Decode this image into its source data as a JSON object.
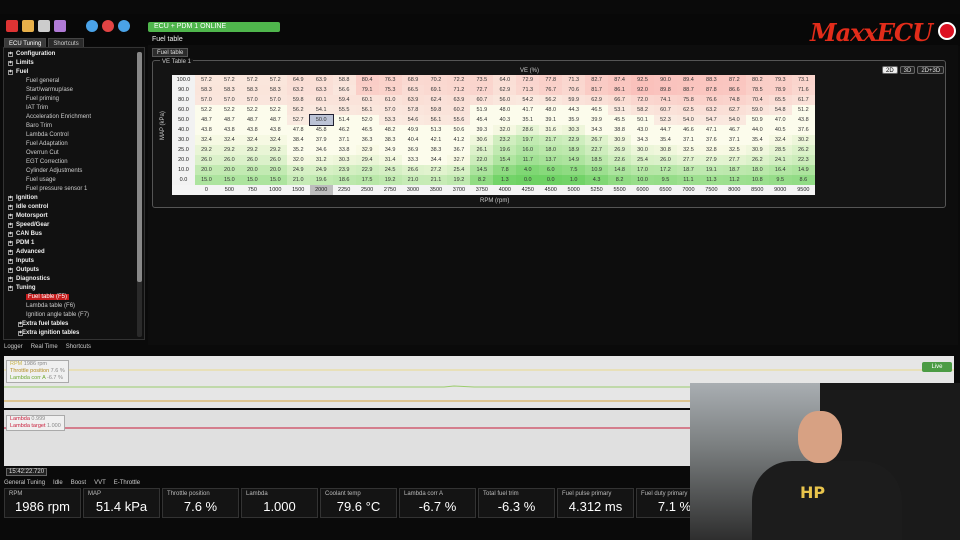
{
  "app": {
    "status": "ECU + PDM 1 ONLINE",
    "panel_title": "Fuel table",
    "logo": "MaxxECU"
  },
  "toolbar_icons": [
    "close-icon",
    "folder-icon",
    "save-icon",
    "settings-icon",
    "info-icon",
    "record-icon",
    "download-icon"
  ],
  "left_tabs": [
    "ECU Tuning",
    "Shortcuts"
  ],
  "sidebar": [
    {
      "label": "Configuration",
      "level": "top"
    },
    {
      "label": "Limits",
      "level": "top"
    },
    {
      "label": "Fuel",
      "level": "top"
    },
    {
      "label": "Fuel general",
      "level": "sub"
    },
    {
      "label": "Start/warmup/ase",
      "level": "sub"
    },
    {
      "label": "Fuel priming",
      "level": "sub"
    },
    {
      "label": "IAT Trim",
      "level": "sub"
    },
    {
      "label": "Acceleration Enrichment",
      "level": "sub"
    },
    {
      "label": "Baro Trim",
      "level": "sub"
    },
    {
      "label": "Lambda Control",
      "level": "sub"
    },
    {
      "label": "Fuel Adaptation",
      "level": "sub"
    },
    {
      "label": "Overrun Cut",
      "level": "sub"
    },
    {
      "label": "EGT Correction",
      "level": "sub"
    },
    {
      "label": "Cylinder Adjustments",
      "level": "sub"
    },
    {
      "label": "Fuel usage",
      "level": "sub"
    },
    {
      "label": "Fuel pressure sensor 1",
      "level": "sub"
    },
    {
      "label": "Ignition",
      "level": "top"
    },
    {
      "label": "Idle control",
      "level": "top"
    },
    {
      "label": "Motorsport",
      "level": "top"
    },
    {
      "label": "Speed/Gear",
      "level": "top"
    },
    {
      "label": "CAN Bus",
      "level": "top"
    },
    {
      "label": "PDM 1",
      "level": "top"
    },
    {
      "label": "Advanced",
      "level": "top"
    },
    {
      "label": "Inputs",
      "level": "top"
    },
    {
      "label": "Outputs",
      "level": "top"
    },
    {
      "label": "Diagnostics",
      "level": "top"
    },
    {
      "label": "Tuning",
      "level": "top"
    },
    {
      "label": "Fuel table (F5)",
      "level": "sub",
      "selected": true
    },
    {
      "label": "Lambda table (F6)",
      "level": "sub"
    },
    {
      "label": "Ignition angle table (F7)",
      "level": "sub"
    },
    {
      "label": "Extra fuel tables",
      "level": "sub2"
    },
    {
      "label": "Extra ignition tables",
      "level": "sub2"
    }
  ],
  "fuel_tab": "Fuel table",
  "ve_table": {
    "group_label": "VE Table 1",
    "title": "VE (%)",
    "y_axis_label": "MAP (kPa)",
    "x_axis_label": "RPM (rpm)",
    "view_buttons": [
      "2D",
      "3D",
      "2D+3D"
    ],
    "rpm": [
      "0",
      "500",
      "750",
      "1000",
      "1500",
      "2000",
      "2250",
      "2500",
      "2750",
      "3000",
      "3500",
      "3700",
      "3750",
      "4000",
      "4250",
      "4500",
      "5000",
      "5250",
      "5500",
      "6000",
      "6500",
      "7000",
      "7500",
      "8000",
      "8500",
      "9000",
      "9500"
    ],
    "map": [
      "100.0",
      "90.0",
      "80.0",
      "60.0",
      "50.0",
      "40.0",
      "30.0",
      "25.0",
      "20.0",
      "10.0",
      "0.0"
    ],
    "rows": [
      [
        "57.2",
        "57.2",
        "57.2",
        "57.2",
        "64.9",
        "63.9",
        "58.8",
        "80.4",
        "76.3",
        "68.9",
        "70.2",
        "72.2",
        "73.5",
        "64.0",
        "72.9",
        "77.8",
        "71.3",
        "82.7",
        "87.4",
        "92.5",
        "90.0",
        "89.4",
        "88.3",
        "87.2",
        "80.2",
        "79.3",
        "73.1"
      ],
      [
        "58.3",
        "58.3",
        "58.3",
        "58.3",
        "63.2",
        "63.3",
        "56.6",
        "79.1",
        "75.3",
        "66.5",
        "69.1",
        "71.2",
        "72.7",
        "62.9",
        "71.3",
        "76.7",
        "70.6",
        "81.7",
        "86.1",
        "92.0",
        "89.8",
        "88.7",
        "87.8",
        "86.6",
        "78.5",
        "78.9",
        "71.6"
      ],
      [
        "57.0",
        "57.0",
        "57.0",
        "57.0",
        "59.8",
        "60.1",
        "59.4",
        "60.1",
        "61.0",
        "63.9",
        "62.4",
        "63.9",
        "60.7",
        "56.0",
        "54.2",
        "56.2",
        "59.9",
        "62.9",
        "66.7",
        "72.0",
        "74.1",
        "75.8",
        "76.6",
        "74.8",
        "70.4",
        "65.5",
        "61.7"
      ],
      [
        "52.2",
        "52.2",
        "52.2",
        "52.2",
        "56.2",
        "54.1",
        "55.5",
        "56.1",
        "57.0",
        "57.8",
        "59.8",
        "60.2",
        "51.9",
        "48.0",
        "41.7",
        "48.0",
        "44.3",
        "46.5",
        "53.1",
        "58.2",
        "60.7",
        "62.5",
        "63.2",
        "62.7",
        "59.0",
        "54.8",
        "51.2"
      ],
      [
        "48.7",
        "48.7",
        "48.7",
        "48.7",
        "52.7",
        "50.0",
        "51.4",
        "52.0",
        "53.3",
        "54.6",
        "56.1",
        "55.6",
        "45.4",
        "40.3",
        "35.1",
        "39.1",
        "35.9",
        "39.9",
        "45.5",
        "50.1",
        "52.3",
        "54.0",
        "54.7",
        "54.0",
        "50.9",
        "47.0",
        "43.8"
      ],
      [
        "43.8",
        "43.8",
        "43.8",
        "43.8",
        "47.8",
        "45.8",
        "46.2",
        "46.5",
        "48.2",
        "49.9",
        "51.3",
        "50.6",
        "39.3",
        "32.0",
        "28.6",
        "31.6",
        "30.3",
        "34.3",
        "38.8",
        "43.0",
        "44.7",
        "46.6",
        "47.1",
        "46.7",
        "44.0",
        "40.5",
        "37.6"
      ],
      [
        "32.4",
        "32.4",
        "32.4",
        "32.4",
        "38.4",
        "37.9",
        "37.1",
        "36.3",
        "38.3",
        "40.4",
        "42.1",
        "41.2",
        "30.6",
        "23.2",
        "19.7",
        "21.7",
        "22.9",
        "26.7",
        "30.9",
        "34.3",
        "35.4",
        "37.1",
        "37.6",
        "37.1",
        "35.4",
        "32.4",
        "30.2"
      ],
      [
        "29.2",
        "29.2",
        "29.2",
        "29.2",
        "35.2",
        "34.6",
        "33.8",
        "32.9",
        "34.9",
        "36.9",
        "38.3",
        "36.7",
        "26.1",
        "19.6",
        "16.0",
        "18.0",
        "18.9",
        "22.7",
        "26.9",
        "30.0",
        "30.8",
        "32.5",
        "32.8",
        "32.5",
        "30.9",
        "28.5",
        "26.2"
      ],
      [
        "26.0",
        "26.0",
        "26.0",
        "26.0",
        "32.0",
        "31.2",
        "30.3",
        "29.4",
        "31.4",
        "33.3",
        "34.4",
        "32.7",
        "22.0",
        "15.4",
        "11.7",
        "13.7",
        "14.9",
        "18.5",
        "22.6",
        "25.4",
        "26.0",
        "27.7",
        "27.9",
        "27.7",
        "26.2",
        "24.1",
        "22.3"
      ],
      [
        "20.0",
        "20.0",
        "20.0",
        "20.0",
        "24.9",
        "24.9",
        "23.9",
        "22.9",
        "24.5",
        "26.6",
        "27.2",
        "25.4",
        "14.5",
        "7.8",
        "4.0",
        "6.0",
        "7.5",
        "10.9",
        "14.8",
        "17.0",
        "17.2",
        "18.7",
        "19.1",
        "18.7",
        "18.0",
        "16.4",
        "14.9"
      ],
      [
        "15.0",
        "15.0",
        "15.0",
        "15.0",
        "21.0",
        "19.6",
        "18.6",
        "17.5",
        "19.2",
        "21.0",
        "21.1",
        "19.2",
        "8.2",
        "1.3",
        "0.0",
        "0.0",
        "1.0",
        "4.3",
        "8.2",
        "10.0",
        "9.5",
        "11.1",
        "11.3",
        "11.2",
        "10.8",
        "9.5",
        "8.6"
      ]
    ],
    "highlight": {
      "row": 4,
      "col": 5
    }
  },
  "log_tabs": [
    "Logger",
    "Real Time",
    "Shortcuts"
  ],
  "live_button": "Live",
  "plot1_legend": [
    {
      "name": "RPM",
      "value": "1986 rpm",
      "color": "#c9b44a"
    },
    {
      "name": "Throttle position",
      "value": "7.6 %",
      "color": "#b38b1e"
    },
    {
      "name": "Lambda corr A",
      "value": "-6.7 %",
      "color": "#6da82f"
    }
  ],
  "plot2_legend": [
    {
      "name": "Lambda",
      "value": "0.999",
      "color": "#c81d3a"
    },
    {
      "name": "Lambda target",
      "value": "1.000",
      "color": "#c81d3a"
    }
  ],
  "timestamp": "15:42:22.720",
  "bottom_tabs": [
    "General Tuning",
    "Idle",
    "Boost",
    "VVT",
    "E-Throttle"
  ],
  "gauges": [
    {
      "label": "RPM",
      "value": "1986 rpm"
    },
    {
      "label": "MAP",
      "value": "51.4 kPa"
    },
    {
      "label": "Throttle position",
      "value": "7.6 %"
    },
    {
      "label": "Lambda",
      "value": "1.000"
    },
    {
      "label": "Coolant temp",
      "value": "79.6 °C"
    },
    {
      "label": "Lambda corr A",
      "value": "-6.7 %"
    },
    {
      "label": "Total fuel trim",
      "value": "-6.3 %"
    },
    {
      "label": "Fuel pulse primary",
      "value": "4.312 ms"
    },
    {
      "label": "Fuel duty primary",
      "value": "7.1 %"
    }
  ],
  "webcam": {
    "shirt_text": "HP"
  }
}
